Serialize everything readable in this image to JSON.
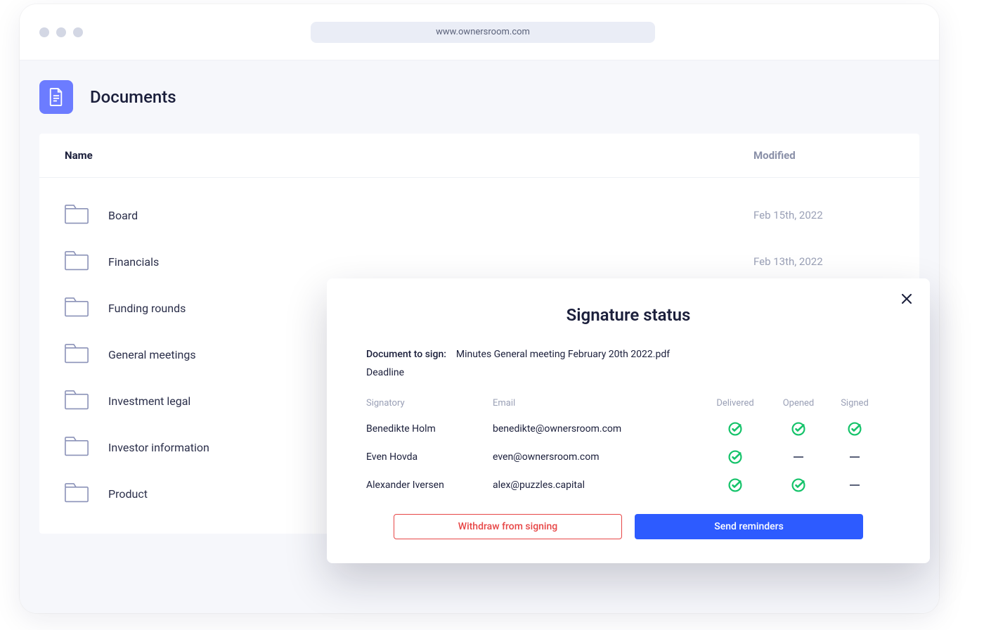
{
  "browser": {
    "url": "www.ownersroom.com"
  },
  "page": {
    "title": "Documents"
  },
  "table": {
    "columns": {
      "name": "Name",
      "modified": "Modified"
    },
    "rows": [
      {
        "name": "Board",
        "modified": "Feb 15th, 2022"
      },
      {
        "name": "Financials",
        "modified": "Feb 13th, 2022"
      },
      {
        "name": "Funding rounds",
        "modified": ""
      },
      {
        "name": "General meetings",
        "modified": ""
      },
      {
        "name": "Investment legal",
        "modified": ""
      },
      {
        "name": "Investor information",
        "modified": ""
      },
      {
        "name": "Product",
        "modified": ""
      }
    ]
  },
  "modal": {
    "title": "Signature status",
    "doc_label": "Document to sign:",
    "doc_name": "Minutes General meeting February 20th 2022.pdf",
    "deadline_label": "Deadline",
    "columns": {
      "signatory": "Signatory",
      "email": "Email",
      "delivered": "Delivered",
      "opened": "Opened",
      "signed": "Signed"
    },
    "rows": [
      {
        "signatory": "Benedikte Holm",
        "email": "benedikte@ownersroom.com",
        "delivered": true,
        "opened": true,
        "signed": true
      },
      {
        "signatory": "Even Hovda",
        "email": "even@ownersroom.com",
        "delivered": true,
        "opened": false,
        "signed": false
      },
      {
        "signatory": "Alexander Iversen",
        "email": "alex@puzzles.capital",
        "delivered": true,
        "opened": true,
        "signed": false
      }
    ],
    "withdraw_label": "Withdraw from signing",
    "send_label": "Send reminders"
  }
}
